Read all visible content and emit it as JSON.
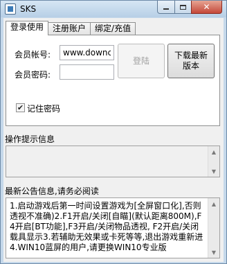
{
  "window": {
    "title": "SKS"
  },
  "tabs": [
    "登录使用",
    "注册账户",
    "绑定/充值"
  ],
  "login": {
    "account_label": "会员帐号:",
    "account_value": "www.downcc",
    "password_label": "会员密码:",
    "password_value": "",
    "login_button": "登陆",
    "download_button": "下载最新版本",
    "remember_label": "记住密码",
    "remember_checked": true
  },
  "hint_section": {
    "label": "操作提示信息",
    "text": ""
  },
  "notice_section": {
    "label": "最新公告信息,请务必阅读",
    "text": "1.启动游戏后第一时间设置游戏为[全屏窗口化],否则透视不准确)2.F1开启/关闭[自瞄](默认距离800M),F4开启[BT功能],F3开启/关闭物品透视, F2开启/关闭载具显示3.若辅助无效果或卡死等等,退出游戏重新进4.WIN10蓝屏的用户,请更换WIN10专业版"
  },
  "icons": {
    "minimize": "minimize-icon",
    "maximize": "maximize-icon",
    "close": "close-icon",
    "app": "app-icon",
    "scroll_up": "scroll-up-icon",
    "scroll_down": "scroll-down-icon",
    "check": "checkmark-icon"
  },
  "colors": {
    "titlebar": "#c5d8ea",
    "close_button": "#c4483a",
    "panel_background": "#f0f0f0"
  }
}
